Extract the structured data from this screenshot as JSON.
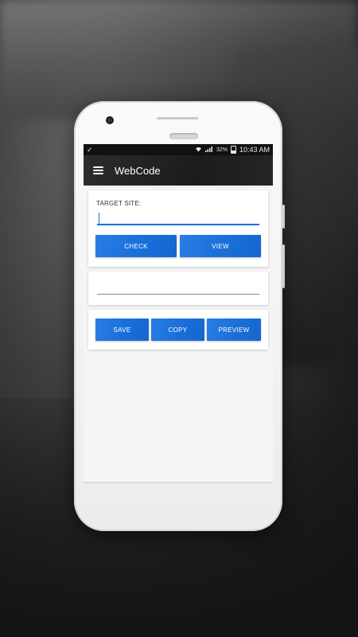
{
  "status_bar": {
    "check_icon": "check-icon",
    "wifi_icon": "wifi-icon",
    "signal_icon": "signal-icon",
    "battery_percent": "32%",
    "time": "10:43 AM"
  },
  "app_bar": {
    "menu_icon": "hamburger-menu-icon",
    "title": "WebCode"
  },
  "target_card": {
    "label": "TARGET SITE:",
    "input_value": "",
    "check_label": "CHECK",
    "view_label": "VIEW"
  },
  "code_card": {
    "value": ""
  },
  "actions_card": {
    "save_label": "SAVE",
    "copy_label": "COPY",
    "preview_label": "PREVIEW"
  },
  "colors": {
    "accent": "#1a6fd8",
    "app_bar": "#1f1f1f"
  }
}
